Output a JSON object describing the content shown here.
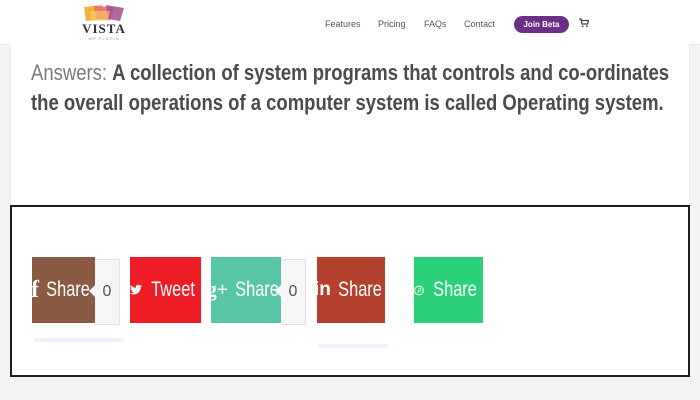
{
  "header": {
    "logo": {
      "text": "VISTA",
      "subtext": "WP PLUGIN"
    },
    "nav": [
      "Features",
      "Pricing",
      "FAQs",
      "Contact"
    ],
    "cta_label": "Join Beta",
    "cart_icon": "cart-icon"
  },
  "article": {
    "answer_label": "Answers:",
    "answer_text": "A collection of system programs that controls and co-ordinates the overall operations of a computer system is called Operating system."
  },
  "share": {
    "facebook": {
      "icon": "f",
      "label": "Share",
      "count": "0",
      "color": "#8a5a44"
    },
    "twitter": {
      "icon": "twitter-bird-icon",
      "label": "Tweet",
      "color": "#ee1c25"
    },
    "googleplus": {
      "icon": "g+",
      "label": "Share",
      "count": "0",
      "color": "#58c5a6"
    },
    "linkedin": {
      "icon": "in",
      "label": "Share",
      "color": "#b3412e"
    },
    "pinterest": {
      "icon": "pinterest-icon",
      "label": "Share",
      "color": "#2bd17a"
    }
  },
  "colors": {
    "accent": "#6b2f86"
  }
}
